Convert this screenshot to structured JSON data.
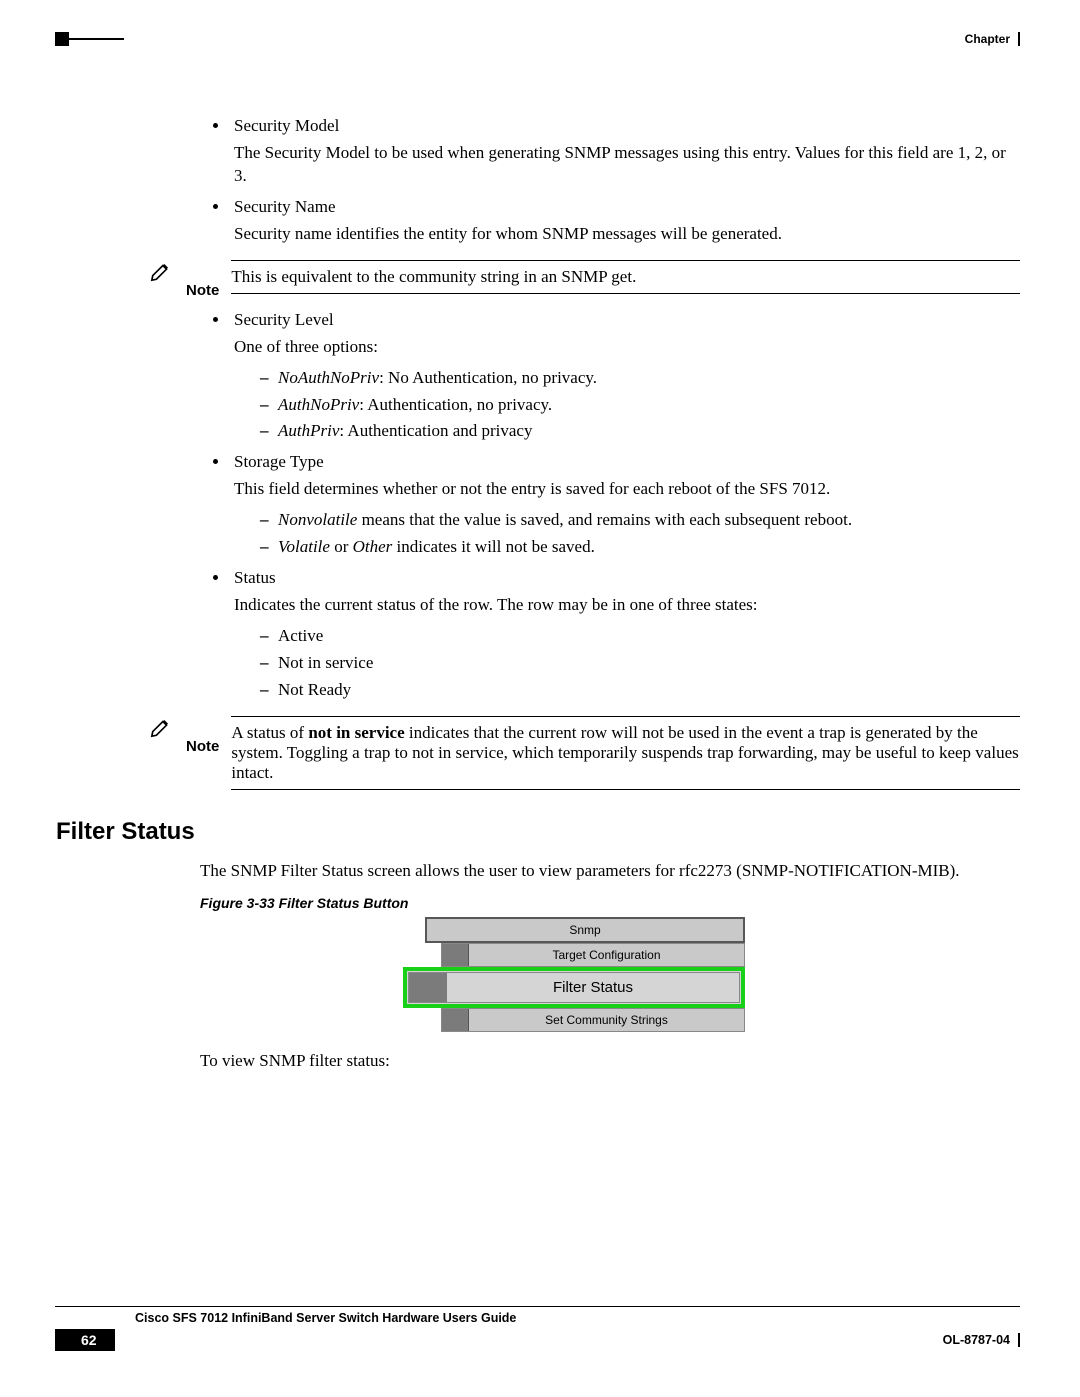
{
  "header": {
    "right_label": "Chapter"
  },
  "bullets1": {
    "sec_model": {
      "title": "Security Model",
      "desc": "The Security Model to be used when generating SNMP messages using this entry. Values for this field are 1, 2, or 3."
    },
    "sec_name": {
      "title": "Security Name",
      "desc": "Security name identifies the entity for whom SNMP messages will be generated."
    }
  },
  "note1": {
    "label": "Note",
    "text": "This is equivalent to the community string in an SNMP get."
  },
  "bullets2": {
    "sec_level": {
      "title": "Security Level",
      "intro": "One of three options:",
      "opts": {
        "a": {
          "term": "NoAuthNoPriv",
          "rest": ": No Authentication, no privacy."
        },
        "b": {
          "term": "AuthNoPriv",
          "rest": ": Authentication, no privacy."
        },
        "c": {
          "term": "AuthPriv",
          "rest": ": Authentication and privacy"
        }
      }
    },
    "storage": {
      "title": "Storage Type",
      "desc": "This field determines whether or not the entry is saved for each reboot of the SFS 7012.",
      "opts": {
        "a": {
          "term": "Nonvolatile",
          "rest": " means that the value is saved, and remains with each subsequent reboot."
        },
        "b": {
          "term1": "Volatile",
          "mid": " or ",
          "term2": "Other",
          "rest": " indicates it will not be saved."
        }
      }
    },
    "status": {
      "title": "Status",
      "desc": "Indicates the current status of the row. The row may be in one of three states:",
      "opts": {
        "a": "Active",
        "b": "Not in service",
        "c": "Not Ready"
      }
    }
  },
  "note2": {
    "label": "Note",
    "pre": "A status of ",
    "bold": "not in service",
    "post": " indicates that the current row will not be used in the event a trap is generated by the system. Toggling a trap to not in service, which temporarily suspends trap forwarding, may be useful to keep values intact."
  },
  "section": {
    "heading": "Filter Status",
    "para": "The SNMP Filter Status screen allows the user to view parameters for rfc2273 (SNMP-NOTIFICATION-MIB).",
    "fig_caption": "Figure 3-33   Filter Status Button",
    "closing": "To view SNMP filter status:"
  },
  "figure": {
    "row1": "Snmp",
    "row2": "Target Configuration",
    "row3": "Filter Status",
    "row4": "Set Community Strings"
  },
  "footer": {
    "guide": "Cisco SFS 7012 InfiniBand Server Switch Hardware Users Guide",
    "page": "62",
    "doc": "OL-8787-04"
  }
}
